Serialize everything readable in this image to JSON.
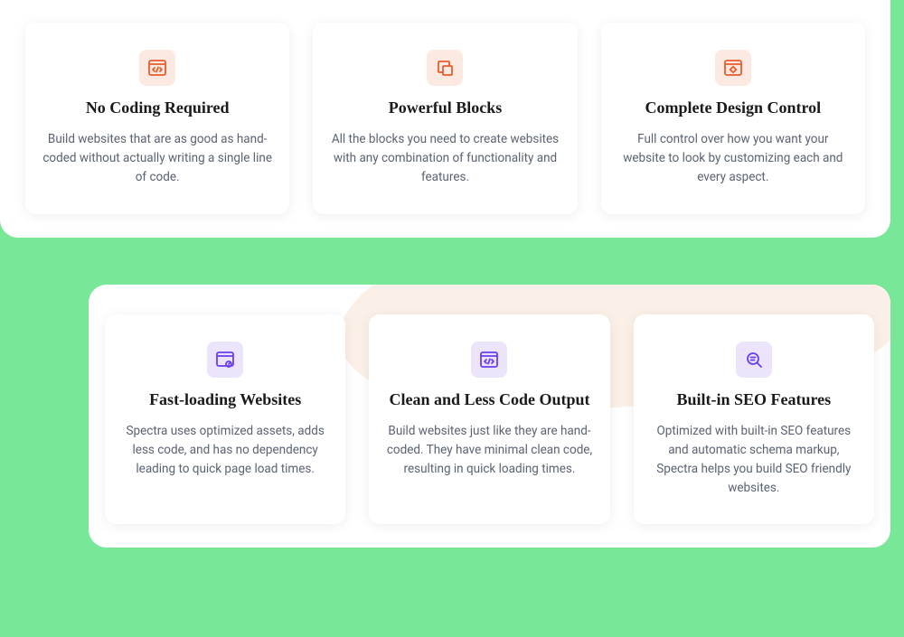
{
  "section1": {
    "cards": [
      {
        "title": "No Coding Required",
        "desc": "Build websites that are as good as hand-coded without actually writing a single line of code."
      },
      {
        "title": "Powerful Blocks",
        "desc": "All the blocks you need to create websites with any combination of functionality and features."
      },
      {
        "title": "Complete Design Control",
        "desc": "Full control over how you want your website to look by customizing each and every aspect."
      }
    ]
  },
  "section2": {
    "cards": [
      {
        "title": "Fast-loading Websites",
        "desc": "Spectra uses optimized assets, adds less code, and has no dependency leading to quick page load times."
      },
      {
        "title": "Clean and Less Code Output",
        "desc": "Build websites just like they are hand-coded. They have minimal clean code, resulting in quick loading times."
      },
      {
        "title": "Built-in SEO Features",
        "desc": "Optimized with built-in SEO features and automatic schema markup, Spectra helps you build SEO friendly websites."
      }
    ]
  }
}
